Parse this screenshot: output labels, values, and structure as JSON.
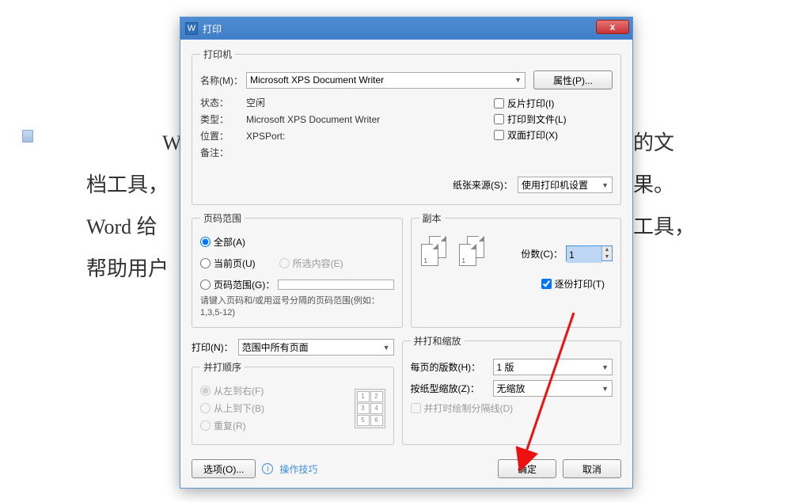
{
  "bg": {
    "l1": "W",
    "l2": "的文",
    "l3": "档工具，",
    "l4": "果。",
    "l5": "Word 给",
    "l6": "工具，",
    "l7": "帮助用户"
  },
  "title": "打印",
  "close_glyph": "x",
  "printer": {
    "legend": "打印机",
    "name_label": "名称(M)：",
    "name_value": "Microsoft XPS Document Writer",
    "props_btn": "属性(P)...",
    "status_label": "状态：",
    "status_value": "空闲",
    "type_label": "类型：",
    "type_value": "Microsoft XPS Document Writer",
    "where_label": "位置：",
    "where_value": "XPSPort:",
    "comment_label": "备注：",
    "comment_value": "",
    "chk_reverse": "反片打印(I)",
    "chk_tofile": "打印到文件(L)",
    "chk_duplex": "双面打印(X)",
    "papersrc_label": "纸张来源(S)：",
    "papersrc_value": "使用打印机设置"
  },
  "range": {
    "legend": "页码范围",
    "all": "全部(A)",
    "current": "当前页(U)",
    "selection": "所选内容(E)",
    "pages_label": "页码范围(G)：",
    "pages_value": "",
    "hint": "请键入页码和/或用逗号分隔的页码范围(例如：1,3,5-12)"
  },
  "copies": {
    "legend": "副本",
    "count_label": "份数(C)：",
    "count_value": "1",
    "collate": "逐份打印(T)"
  },
  "what": {
    "print_label": "打印(N)：",
    "print_value": "范围中所有页面",
    "order_legend": "并打顺序",
    "lr": "从左到右(F)",
    "tb": "从上到下(B)",
    "repeat": "重复(R)"
  },
  "zoom": {
    "legend": "并打和缩放",
    "pps_label": "每页的版数(H)：",
    "pps_value": "1 版",
    "scale_label": "按纸型缩放(Z)：",
    "scale_value": "无缩放",
    "drawlines": "并打时绘制分隔线(D)"
  },
  "footer": {
    "options": "选项(O)...",
    "tips": "操作技巧",
    "ok": "确定",
    "cancel": "取消"
  }
}
